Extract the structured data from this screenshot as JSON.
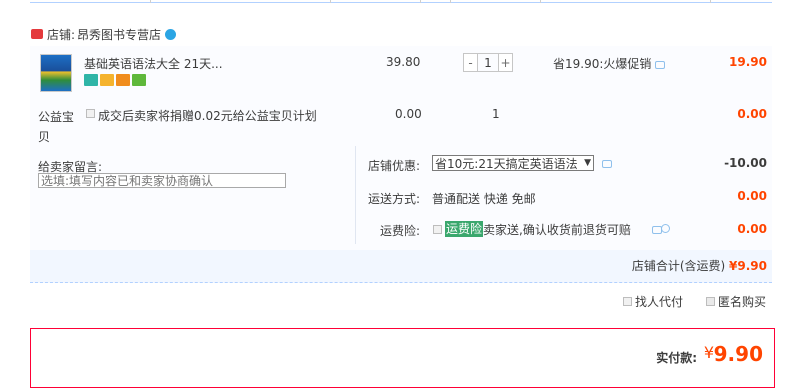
{
  "shop": {
    "prefix": "店铺:",
    "name": "昂秀图书专营店",
    "icon": "shop-icon",
    "chat_icon": "wangwang-icon"
  },
  "item": {
    "title": "基础英语语法大全 21天...",
    "service_icons": [
      "seven-day-return-icon",
      "guarantee-icon",
      "credit-card-icon",
      "invoice-icon"
    ],
    "unit_price": "39.80",
    "quantity": "1",
    "minus_label": "-",
    "plus_label": "+",
    "promo": "省19.90:火爆促销",
    "subtotal": "19.90"
  },
  "charity": {
    "label": "公益宝贝",
    "text": "成交后卖家将捐赠0.02元给公益宝贝计划",
    "price": "0.00",
    "quantity": "1",
    "subtotal": "0.00"
  },
  "memo": {
    "label": "给卖家留言:",
    "placeholder": "选填:填写内容已和卖家协商确认"
  },
  "discount": {
    "label": "店铺优惠:",
    "selected": "省10元:21天搞定英语语法",
    "amount": "-10.00"
  },
  "shipping": {
    "label": "运送方式:",
    "value": "普通配送 快递 免邮",
    "amount": "0.00"
  },
  "insurance": {
    "label": "运费险:",
    "tag": "运费险",
    "text": "卖家送,确认收货前退货可赔",
    "amount": "0.00"
  },
  "shop_total": {
    "label": "店铺合计(含运费)",
    "amount": "¥9.90"
  },
  "options": {
    "pay_for_me": "找人代付",
    "anonymous": "匿名购买"
  },
  "final": {
    "label": "实付款:",
    "currency": "¥",
    "amount": "9.90"
  },
  "colors": {
    "accent_red": "#ff4400",
    "border_red": "#ff0036",
    "zone_blue": "#f2f7ff"
  }
}
